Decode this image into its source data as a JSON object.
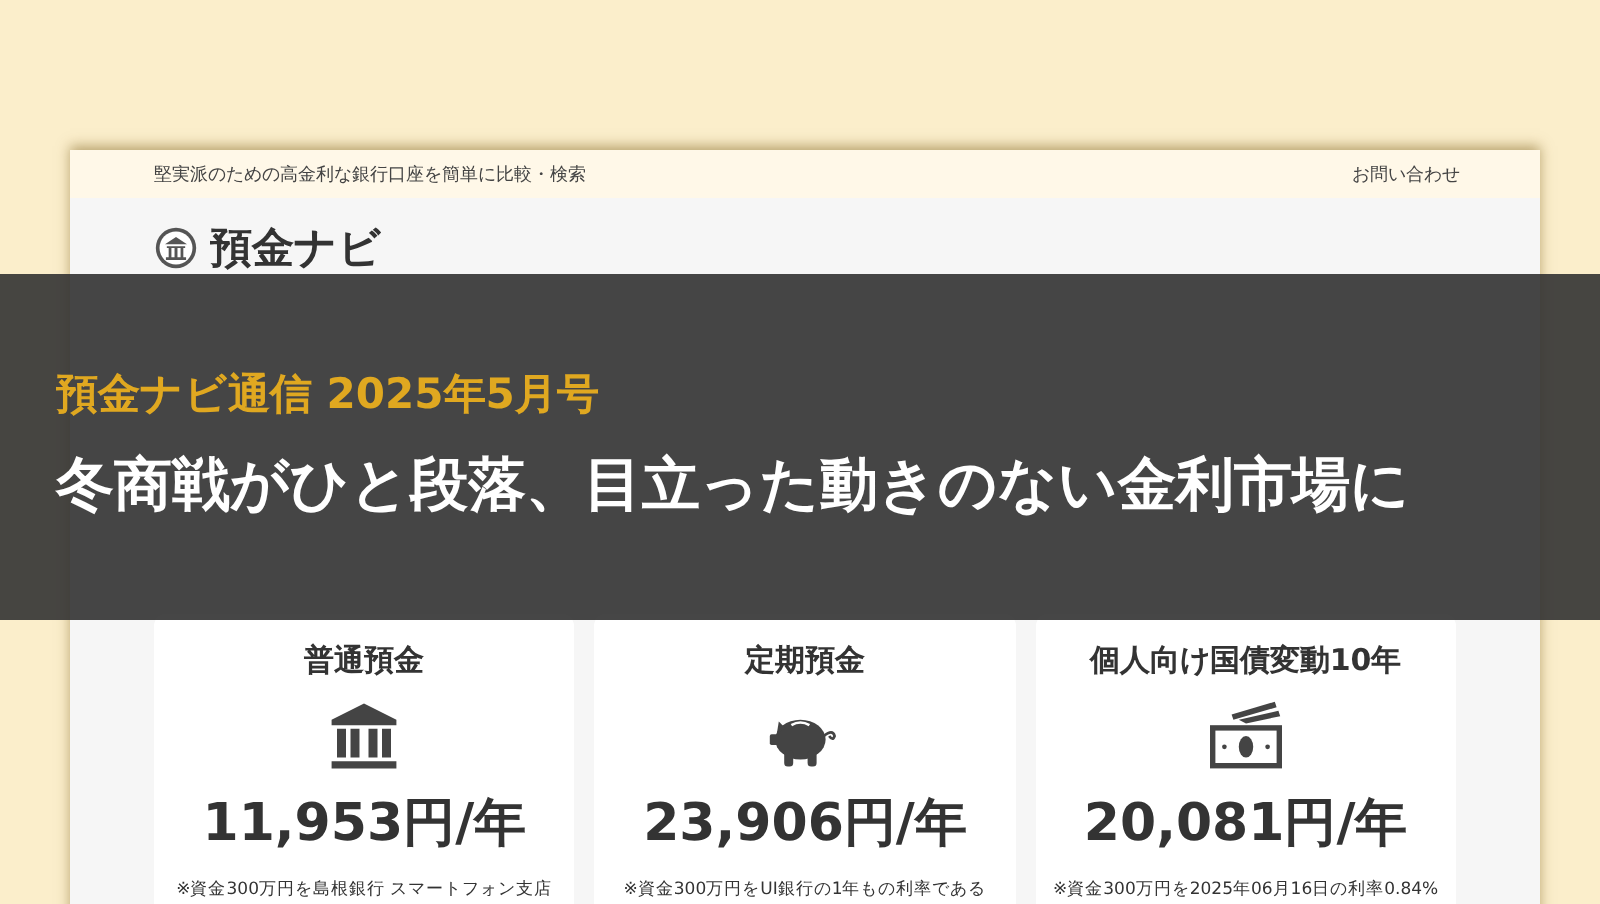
{
  "site": {
    "tagline": "堅実派のための高金利な銀行口座を簡単に比較・検索",
    "contact_link": "お問い合わせ",
    "logo": "預金ナビ",
    "cards": [
      {
        "kind": "bank",
        "title": "普通預金",
        "amount": "11,953円/年",
        "note": "※資金300万円を島根銀行 スマートフォン支店"
      },
      {
        "kind": "piggy",
        "title": "定期預金",
        "amount": "23,906円/年",
        "note": "※資金300万円をUI銀行の1年もの利率である"
      },
      {
        "kind": "money",
        "title": "個人向け国債変動10年",
        "amount": "20,081円/年",
        "note": "※資金300万円を2025年06月16日の利率0.84%"
      }
    ]
  },
  "banner": {
    "issue": "預金ナビ通信 2025年5月号",
    "headline": "冬商戦がひと段落、目立った動きのない金利市場に"
  }
}
